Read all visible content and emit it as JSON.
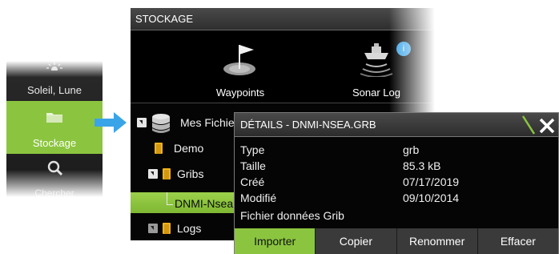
{
  "sidebar": {
    "items": [
      {
        "label": "Soleil, Lune",
        "icon": "sun-moon-icon"
      },
      {
        "label": "Stockage",
        "icon": "folder-icon",
        "selected": true
      },
      {
        "label": "Chercher",
        "icon": "search-icon"
      }
    ]
  },
  "storage": {
    "title": "STOCKAGE",
    "tiles": [
      {
        "label": "Waypoints",
        "icon": "waypoint-flag-icon"
      },
      {
        "label": "Sonar Log",
        "icon": "sonar-log-icon",
        "badge": "i"
      }
    ],
    "tree": [
      {
        "label": "Mes Fichiers",
        "icon": "database-icon",
        "expanded": true
      },
      {
        "label": "Demo",
        "icon": "folder-icon"
      },
      {
        "label": "Gribs",
        "icon": "folder-icon",
        "expanded": true
      },
      {
        "label": "DNMI-Nsea.grb",
        "selected": true
      },
      {
        "label": "Logs",
        "icon": "folder-icon"
      }
    ]
  },
  "details": {
    "title": "DÉTAILS - DNMI-NSEA.GRB",
    "rows": [
      {
        "key": "Type",
        "value": "grb"
      },
      {
        "key": "Taille",
        "value": "85.3 kB"
      },
      {
        "key": "Créé",
        "value": "07/17/2019"
      },
      {
        "key": "Modifié",
        "value": "09/10/2014"
      }
    ],
    "note": "Fichier données Grib",
    "buttons": [
      "Importer",
      "Copier",
      "Renommer",
      "Effacer"
    ]
  },
  "colors": {
    "accent": "#8bc53f",
    "arrow": "#3aa4e8",
    "folder": "#f2b318",
    "badge": "#3aa4e8"
  }
}
